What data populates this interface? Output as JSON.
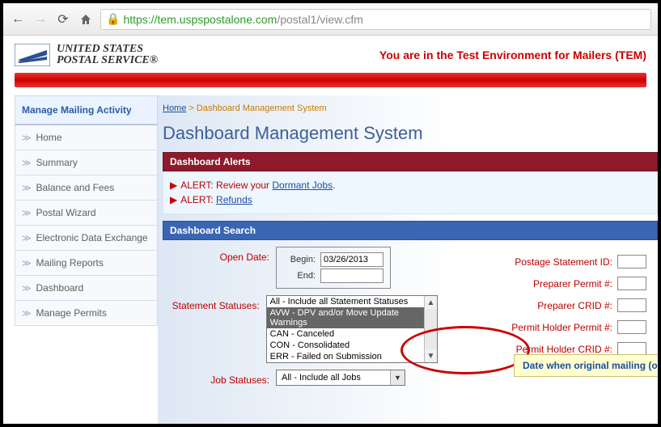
{
  "browser": {
    "url_secure_part": "https",
    "url_host": "://tem.uspspostalone.com",
    "url_path": "/postal1/view.cfm"
  },
  "header": {
    "org_line1": "UNITED STATES",
    "org_line2": "POSTAL SERVICE®",
    "tem_message": "You are in the Test Environment for Mailers (TEM)"
  },
  "sidebar": {
    "title": "Manage Mailing Activity",
    "items": [
      "Home",
      "Summary",
      "Balance and Fees",
      "Postal Wizard",
      "Electronic Data Exchange",
      "Mailing Reports",
      "Dashboard",
      "Manage Permits"
    ]
  },
  "breadcrumb": {
    "home": "Home",
    "sep": " > ",
    "current": "Dashboard Management System"
  },
  "page_title": "Dashboard Management System",
  "alerts": {
    "header": "Dashboard Alerts",
    "line1_prefix": "ALERT: Review your ",
    "line1_link": "Dormant Jobs",
    "line1_suffix": ".",
    "line2_prefix": "ALERT: ",
    "line2_link": "Refunds"
  },
  "search": {
    "header": "Dashboard Search",
    "open_date_label": "Open Date:",
    "begin_label": "Begin:",
    "begin_value": "03/26/2013",
    "end_label": "End:",
    "end_value": "",
    "tooltip": "Date when original mailing (or mailing job) was submitted",
    "statement_statuses_label": "Statement Statuses:",
    "statement_options": [
      "All - Include all Statement Statuses",
      "AVW - DPV and/or Move Update Warnings",
      "CAN - Canceled",
      "CON - Consolidated",
      "ERR - Failed on Submission"
    ],
    "statement_selected_index": 1,
    "job_statuses_label": "Job Statuses:",
    "job_selected": "All - Include all Jobs",
    "right_labels": {
      "postage_statement_id": "Postage Statement ID:",
      "preparer_permit": "Preparer Permit #:",
      "preparer_crid": "Preparer CRID #:",
      "permit_holder_permit": "Permit Holder Permit #:",
      "permit_holder_crid": "Permit Holder CRID #:"
    }
  }
}
